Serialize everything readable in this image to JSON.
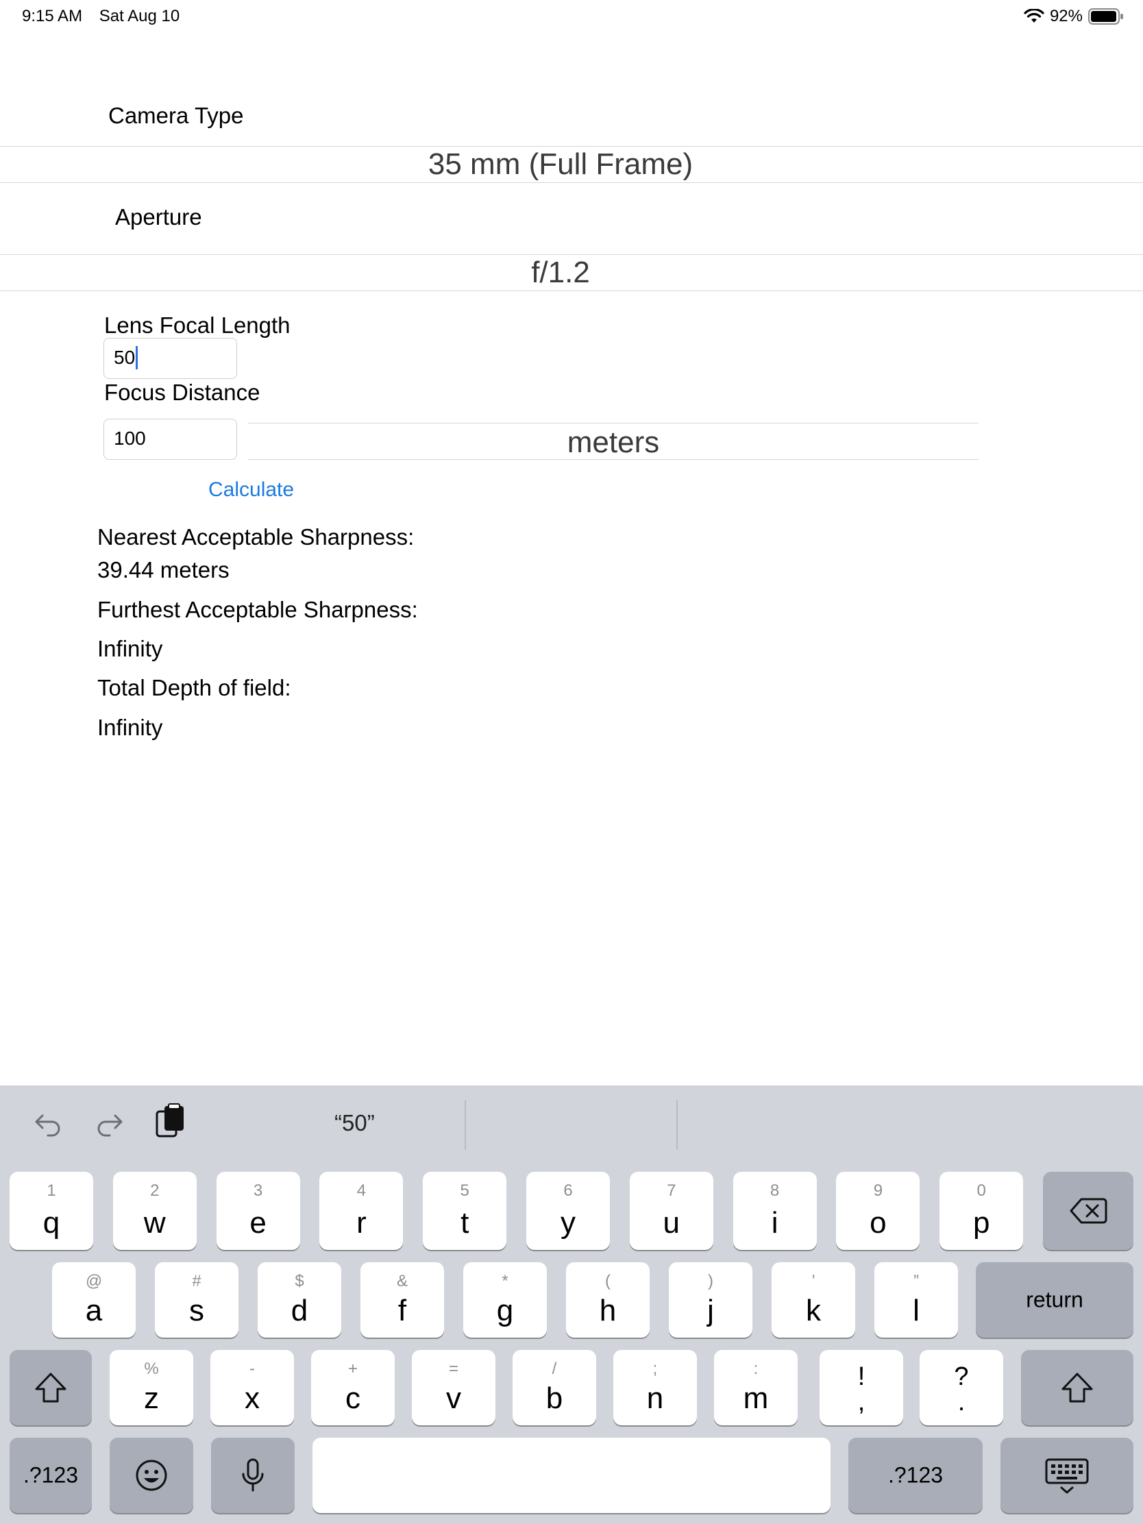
{
  "status_bar": {
    "time": "9:15 AM",
    "date": "Sat Aug 10",
    "battery": "92%",
    "icons": [
      "wifi-icon",
      "battery-icon"
    ]
  },
  "form": {
    "camera_type_label": "Camera Type",
    "camera_type_value": "35 mm (Full Frame)",
    "aperture_label": "Aperture",
    "aperture_value": "f/1.2",
    "focal_length_label": "Lens Focal Length",
    "focal_length_value": "50",
    "focus_distance_label": "Focus Distance",
    "focus_distance_value": "100",
    "units_value": "meters",
    "calculate_label": "Calculate"
  },
  "results": {
    "nearest_label": "Nearest Acceptable Sharpness:",
    "nearest_value": "39.44 meters",
    "furthest_label": "Furthest Acceptable Sharpness:",
    "furthest_value": "Infinity",
    "total_label": "Total Depth of field:",
    "total_value": "Infinity"
  },
  "keyboard": {
    "suggestion": "“50”",
    "toolbar_icons": [
      "undo-icon",
      "redo-icon",
      "paste-icon"
    ],
    "row1": [
      {
        "hint": "1",
        "key": "q"
      },
      {
        "hint": "2",
        "key": "w"
      },
      {
        "hint": "3",
        "key": "e"
      },
      {
        "hint": "4",
        "key": "r"
      },
      {
        "hint": "5",
        "key": "t"
      },
      {
        "hint": "6",
        "key": "y"
      },
      {
        "hint": "7",
        "key": "u"
      },
      {
        "hint": "8",
        "key": "i"
      },
      {
        "hint": "9",
        "key": "o"
      },
      {
        "hint": "0",
        "key": "p"
      }
    ],
    "row2": [
      {
        "hint": "@",
        "key": "a"
      },
      {
        "hint": "#",
        "key": "s"
      },
      {
        "hint": "$",
        "key": "d"
      },
      {
        "hint": "&",
        "key": "f"
      },
      {
        "hint": "*",
        "key": "g"
      },
      {
        "hint": "(",
        "key": "h"
      },
      {
        "hint": ")",
        "key": "j"
      },
      {
        "hint": "’",
        "key": "k"
      },
      {
        "hint": "”",
        "key": "l"
      }
    ],
    "row3": [
      {
        "hint": "%",
        "key": "z"
      },
      {
        "hint": "-",
        "key": "x"
      },
      {
        "hint": "+",
        "key": "c"
      },
      {
        "hint": "=",
        "key": "v"
      },
      {
        "hint": "/",
        "key": "b"
      },
      {
        "hint": ";",
        "key": "n"
      },
      {
        "hint": ":",
        "key": "m"
      }
    ],
    "exclaim_top": "!",
    "exclaim_bottom": ",",
    "question_top": "?",
    "question_bottom": ".",
    "return_label": "return",
    "numbers_label": ".?123",
    "icons": [
      "delete-icon",
      "shift-icon",
      "emoji-icon",
      "microphone-icon",
      "keyboard-dismiss-icon"
    ]
  }
}
